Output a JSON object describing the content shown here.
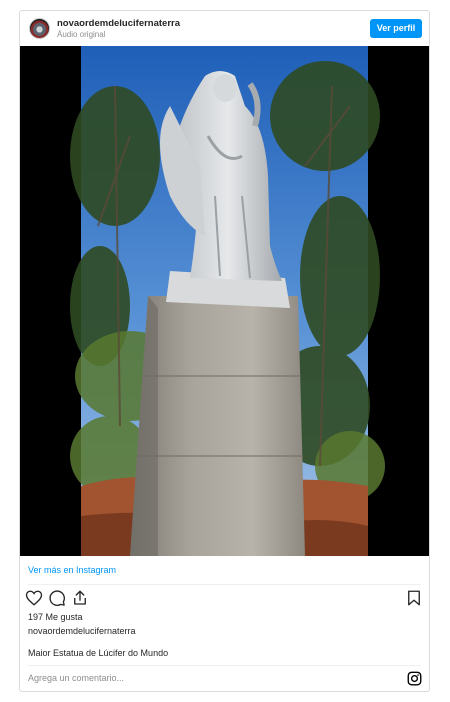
{
  "header": {
    "username": "novaordemdelucifernaterra",
    "audio_label": "Áudio original",
    "follow_label": "Ver perfil"
  },
  "media": {
    "description_icon": "video-frame"
  },
  "footer": {
    "see_more_label": "Ver más en Instagram",
    "likes_text": "197 Me gusta",
    "owner_username": "novaordemdelucifernaterra",
    "caption": "Maior Estatua de Lúcifer do Mundo",
    "comment_placeholder": "Agrega un comentario..."
  },
  "icons": {
    "like": "heart-icon",
    "comment": "comment-icon",
    "share": "share-icon",
    "save": "bookmark-icon",
    "instagram": "instagram-icon"
  },
  "colors": {
    "accent": "#0095f6",
    "border": "#dbdbdb",
    "muted": "#8e8e8e"
  }
}
